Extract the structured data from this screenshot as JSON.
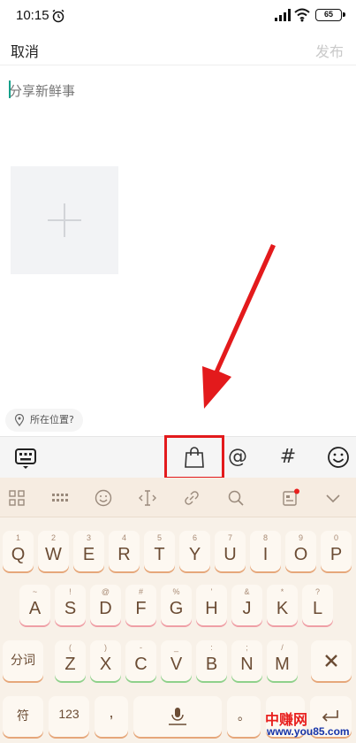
{
  "status_bar": {
    "time": "10:15",
    "battery": "65"
  },
  "header": {
    "cancel_label": "取消",
    "publish_label": "发布"
  },
  "compose": {
    "placeholder": "分享新鲜事"
  },
  "location": {
    "label": "所在位置?"
  },
  "toolbar": {
    "mention_symbol": "@",
    "topic_symbol": "#"
  },
  "keyboard": {
    "rows": [
      [
        {
          "main": "Q",
          "sub": "1"
        },
        {
          "main": "W",
          "sub": "2"
        },
        {
          "main": "E",
          "sub": "3"
        },
        {
          "main": "R",
          "sub": "4"
        },
        {
          "main": "T",
          "sub": "5"
        },
        {
          "main": "Y",
          "sub": "6"
        },
        {
          "main": "U",
          "sub": "7"
        },
        {
          "main": "I",
          "sub": "8"
        },
        {
          "main": "O",
          "sub": "9"
        },
        {
          "main": "P",
          "sub": "0"
        }
      ],
      [
        {
          "main": "A",
          "sub": "~"
        },
        {
          "main": "S",
          "sub": "!"
        },
        {
          "main": "D",
          "sub": "@"
        },
        {
          "main": "F",
          "sub": "#"
        },
        {
          "main": "G",
          "sub": "%"
        },
        {
          "main": "H",
          "sub": "'"
        },
        {
          "main": "J",
          "sub": "&"
        },
        {
          "main": "K",
          "sub": "*"
        },
        {
          "main": "L",
          "sub": "?"
        }
      ],
      [
        {
          "main": "Z",
          "sub": "("
        },
        {
          "main": "X",
          "sub": ")"
        },
        {
          "main": "C",
          "sub": "-"
        },
        {
          "main": "V",
          "sub": "_"
        },
        {
          "main": "B",
          "sub": ":"
        },
        {
          "main": "N",
          "sub": ";"
        },
        {
          "main": "M",
          "sub": "/"
        }
      ]
    ],
    "split_word_label": "分词",
    "symbol_label": "符",
    "number_label": "123",
    "comma_label": ",",
    "period_label": "。"
  },
  "watermark": {
    "title": "中赚网",
    "url": "www.you85.com"
  }
}
